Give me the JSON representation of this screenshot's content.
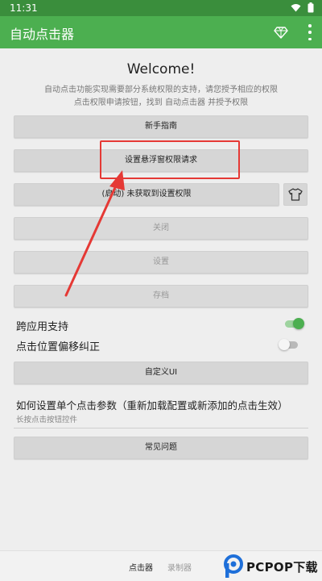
{
  "status_bar": {
    "time": "11:31"
  },
  "app_bar": {
    "title": "自动点击器",
    "icons": [
      "diamond-icon",
      "more-vert-icon"
    ]
  },
  "intro": {
    "welcome": "Welcome!",
    "description_line1": "自动点击功能实现需要部分系统权限的支持，请您授予相应的权限",
    "description_line2": "点击权限申请按钮，找到 自动点击器 并授予权限"
  },
  "buttons": {
    "guide": "新手指南",
    "overlay_permission": "设置悬浮窗权限请求",
    "settings_permission": "(启动)  未获取到设置权限",
    "close": "关闭",
    "settings": "设置",
    "archive": "存档",
    "custom_ui": "自定义UI",
    "faq": "常见问题"
  },
  "toggles": {
    "cross_app": {
      "label": "跨应用支持",
      "on": true
    },
    "offset_correction": {
      "label": "点击位置偏移纠正",
      "on": false
    }
  },
  "help": {
    "title": "如何设置单个点击参数（重新加载配置或新添加的点击生效）",
    "subtitle": "长按点击按钮控件"
  },
  "bottom_nav": {
    "tabs": [
      "点击器",
      "录制器"
    ],
    "active": "点击器"
  },
  "watermark": {
    "text": "PCPOP下载"
  },
  "colors": {
    "primary": "#4caf50",
    "primary_dark": "#3a8e3c",
    "annotation": "#e53935"
  }
}
